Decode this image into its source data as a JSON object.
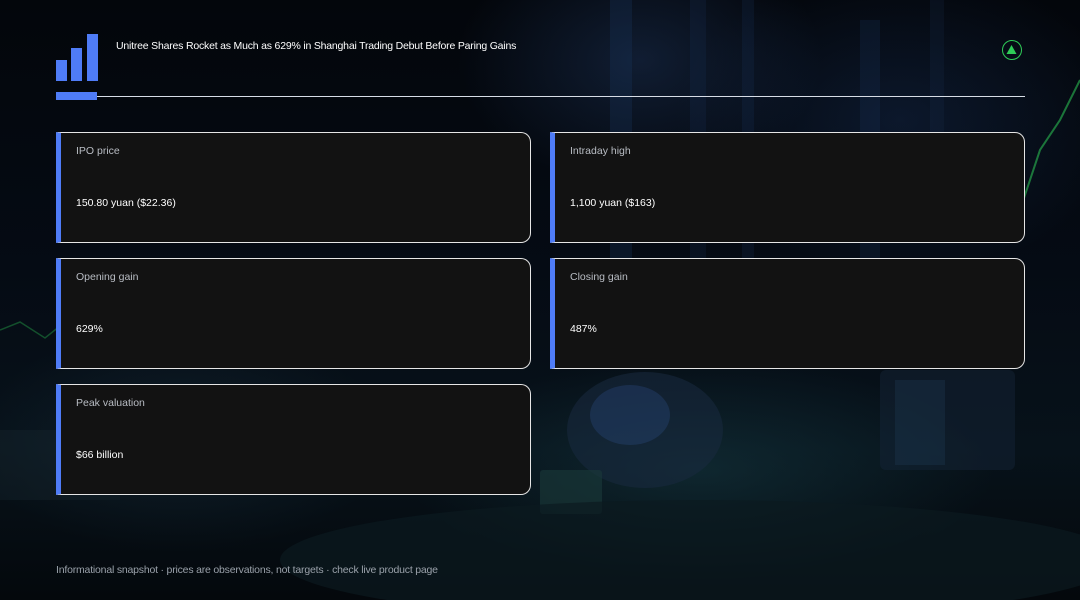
{
  "header": {
    "title": "Unitree Shares Rocket as Much as 629% in Shanghai Trading Debut Before Paring Gains",
    "logo_icon": "bar-chart-icon",
    "badge_icon": "up-triangle-icon"
  },
  "colors": {
    "accent": "#4f7cf7",
    "badge": "#2ecc57",
    "card_bg": "#121212"
  },
  "cards": [
    {
      "label": "IPO price",
      "value": "150.80 yuan ($22.36)"
    },
    {
      "label": "Intraday high",
      "value": "1,100 yuan ($163)"
    },
    {
      "label": "Opening gain",
      "value": "629%"
    },
    {
      "label": "Closing gain",
      "value": "487%"
    },
    {
      "label": "Peak valuation",
      "value": "$66 billion"
    }
  ],
  "footer": {
    "note": "Informational snapshot · prices are observations, not targets · check live product page"
  }
}
